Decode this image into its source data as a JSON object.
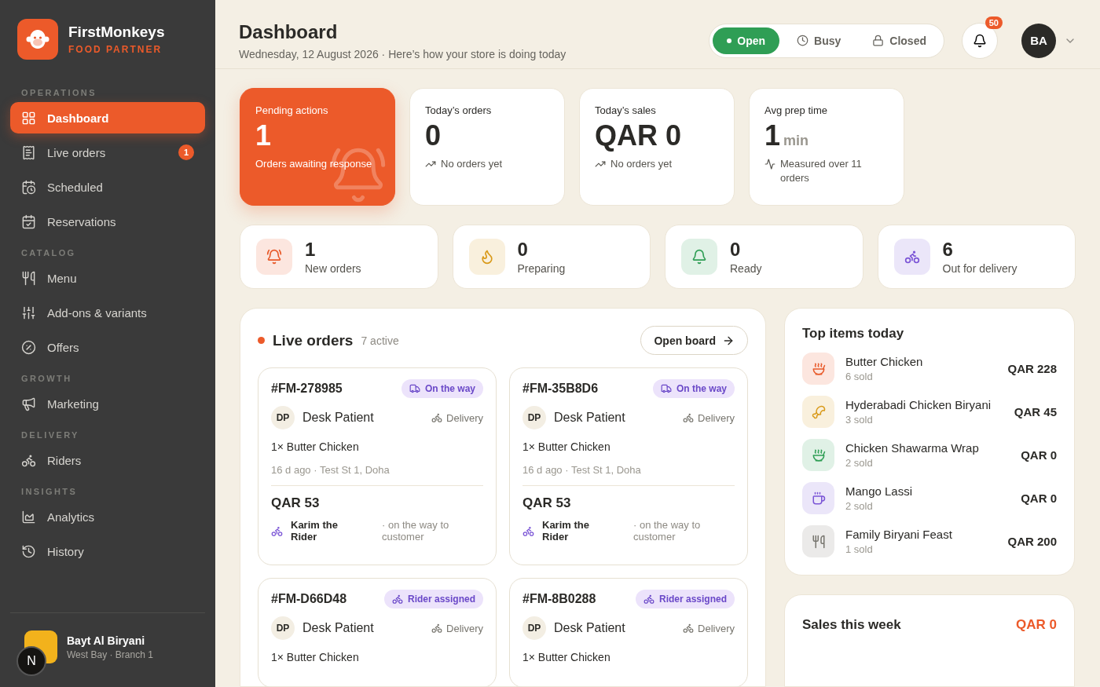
{
  "brand": {
    "name": "FirstMonkeys",
    "tagline": "FOOD PARTNER"
  },
  "sidebar": {
    "sections": [
      {
        "title": "OPERATIONS",
        "items": [
          {
            "label": "Dashboard",
            "selected": true
          },
          {
            "label": "Live orders",
            "selected": false,
            "badge": "1"
          },
          {
            "label": "Scheduled",
            "selected": false
          },
          {
            "label": "Reservations",
            "selected": false
          }
        ]
      },
      {
        "title": "CATALOG",
        "items": [
          {
            "label": "Menu",
            "selected": false
          },
          {
            "label": "Add-ons & variants",
            "selected": false
          },
          {
            "label": "Offers",
            "selected": false
          }
        ]
      },
      {
        "title": "GROWTH",
        "items": [
          {
            "label": "Marketing",
            "selected": false
          }
        ]
      },
      {
        "title": "DELIVERY",
        "items": [
          {
            "label": "Riders",
            "selected": false
          }
        ]
      },
      {
        "title": "INSIGHTS",
        "items": [
          {
            "label": "Analytics",
            "selected": false
          },
          {
            "label": "History",
            "selected": false
          }
        ]
      }
    ],
    "store": {
      "name": "Bayt Al Biryani",
      "branch": "West Bay · Branch 1",
      "dev_badge": "N"
    }
  },
  "header": {
    "title": "Dashboard",
    "subtitle": "Wednesday, 12 August 2026 · Here’s how your store is doing today",
    "status_options": [
      {
        "label": "Open",
        "selected": true
      },
      {
        "label": "Busy",
        "selected": false
      },
      {
        "label": "Closed",
        "selected": false
      }
    ],
    "notifications": "50",
    "user_initials": "BA"
  },
  "summary_cards": [
    {
      "kind": "highlight",
      "label": "Pending actions",
      "value": "1",
      "note": "Orders awaiting response"
    },
    {
      "kind": "plain",
      "label": "Today’s orders",
      "value": "0",
      "note": "No orders yet"
    },
    {
      "kind": "plain",
      "label": "Today’s sales",
      "value": "QAR 0",
      "note": "No orders yet"
    },
    {
      "kind": "plain",
      "label": "Avg prep time",
      "value": "1",
      "unit": "min",
      "note": "Measured over 11 orders"
    }
  ],
  "status_counts": [
    {
      "value": "1",
      "label": "New orders",
      "color": "#e85a2a"
    },
    {
      "value": "0",
      "label": "Preparing",
      "color": "#d99a1a"
    },
    {
      "value": "0",
      "label": "Ready",
      "color": "#2f9e55"
    },
    {
      "value": "6",
      "label": "Out for delivery",
      "color": "#7b55d6"
    }
  ],
  "live_orders": {
    "title": "Live orders",
    "count": "7 active",
    "button": "Open board",
    "orders": [
      {
        "id": "#FM-278985",
        "status": "On the way",
        "kind": "on_the_way",
        "initials": "DP",
        "customer": "Desk Patient",
        "type": "Delivery",
        "items": "1× Butter Chicken",
        "meta": "16 d ago · Test St 1, Doha",
        "total": "QAR 53",
        "rider": "Karim the Rider",
        "rider_note": "· on the way to customer"
      },
      {
        "id": "#FM-35B8D6",
        "status": "On the way",
        "kind": "on_the_way",
        "initials": "DP",
        "customer": "Desk Patient",
        "type": "Delivery",
        "items": "1× Butter Chicken",
        "meta": "16 d ago · Test St 1, Doha",
        "total": "QAR 53",
        "rider": "Karim the Rider",
        "rider_note": "· on the way to customer"
      },
      {
        "id": "#FM-D66D48",
        "status": "Rider assigned",
        "kind": "rider_assigned",
        "initials": "DP",
        "customer": "Desk Patient",
        "type": "Delivery",
        "items": "1× Butter Chicken"
      },
      {
        "id": "#FM-8B0288",
        "status": "Rider assigned",
        "kind": "rider_assigned",
        "initials": "DP",
        "customer": "Desk Patient",
        "type": "Delivery",
        "items": "1× Butter Chicken"
      }
    ]
  },
  "top_items": {
    "title": "Top items today",
    "items": [
      {
        "name": "Butter Chicken",
        "sold": "6 sold",
        "amount": "QAR 228",
        "color": "#e85a2a"
      },
      {
        "name": "Hyderabadi Chicken Biryani",
        "sold": "3 sold",
        "amount": "QAR 45",
        "color": "#d99a1a"
      },
      {
        "name": "Chicken Shawarma Wrap",
        "sold": "2 sold",
        "amount": "QAR 0",
        "color": "#2f9e55"
      },
      {
        "name": "Mango Lassi",
        "sold": "2 sold",
        "amount": "QAR 0",
        "color": "#7b55d6"
      },
      {
        "name": "Family Biryani Feast",
        "sold": "1 sold",
        "amount": "QAR 200",
        "color": "#77756e"
      }
    ]
  },
  "sales_week": {
    "title": "Sales this week",
    "total": "QAR 0"
  }
}
